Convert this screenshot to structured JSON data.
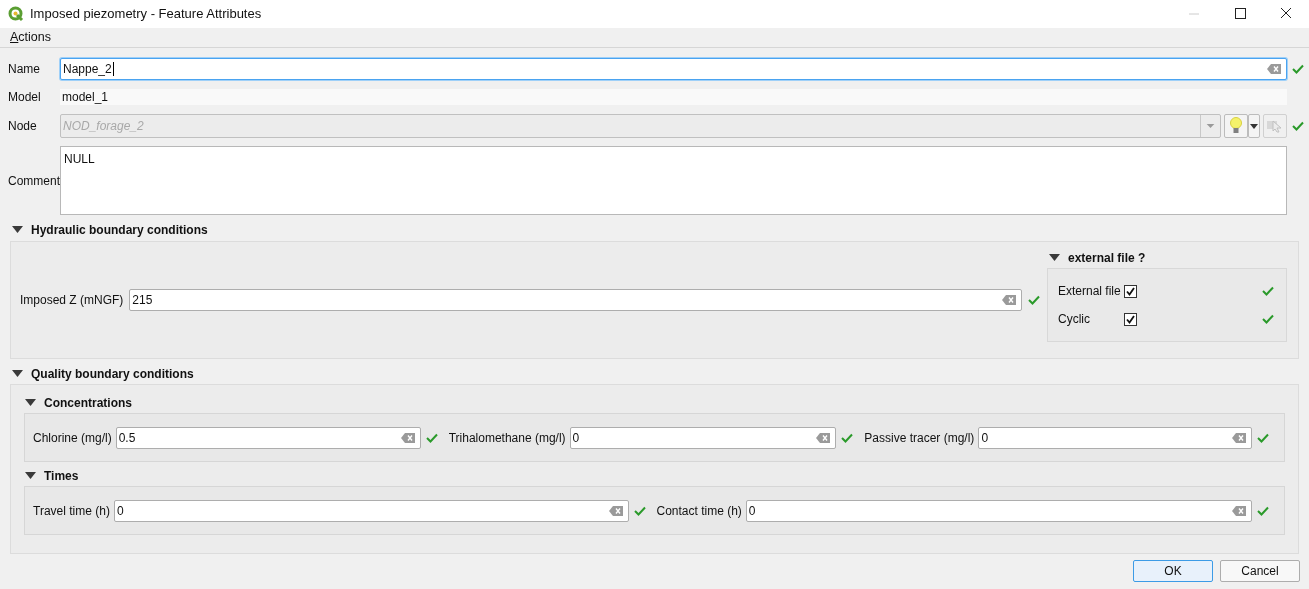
{
  "window": {
    "title": "Imposed piezometry - Feature Attributes"
  },
  "menu": [
    {
      "label": "Actions"
    }
  ],
  "fields": [
    {
      "label": "Name",
      "kind": "text",
      "value": "Nappe_2",
      "focused": true,
      "valid": true
    },
    {
      "label": "Model",
      "kind": "readonly",
      "value": "model_1"
    },
    {
      "label": "Node",
      "kind": "combo",
      "value": "NOD_forage_2",
      "valid": true,
      "disabled": true
    },
    {
      "label": "Comment",
      "kind": "multiline",
      "value": "NULL"
    }
  ],
  "hydraulic": {
    "title": "Hydraulic boundary conditions",
    "expanded": true,
    "field": {
      "label": "Imposed Z (mNGF)",
      "value": "215",
      "valid": true
    },
    "external": {
      "title": "external file ?",
      "expanded": true,
      "options": [
        {
          "label": "External file",
          "checked": true,
          "valid": true
        },
        {
          "label": "Cyclic",
          "checked": true,
          "valid": true
        }
      ]
    }
  },
  "quality": {
    "title": "Quality boundary conditions",
    "expanded": true,
    "groups": [
      {
        "title": "Concentrations",
        "expanded": true,
        "fields": [
          {
            "label": "Chlorine (mg/l)",
            "value": "0.5",
            "valid": true
          },
          {
            "label": "Trihalomethane (mg/l)",
            "value": "0",
            "valid": true
          },
          {
            "label": "Passive tracer (mg/l)",
            "value": "0",
            "valid": true
          }
        ]
      },
      {
        "title": "Times",
        "expanded": true,
        "fields": [
          {
            "label": "Travel time (h)",
            "value": "0",
            "valid": true
          },
          {
            "label": "Contact time (h)",
            "value": "0",
            "valid": true
          }
        ]
      }
    ]
  },
  "buttons": [
    {
      "label": "OK",
      "default": true
    },
    {
      "label": "Cancel",
      "default": false
    }
  ]
}
